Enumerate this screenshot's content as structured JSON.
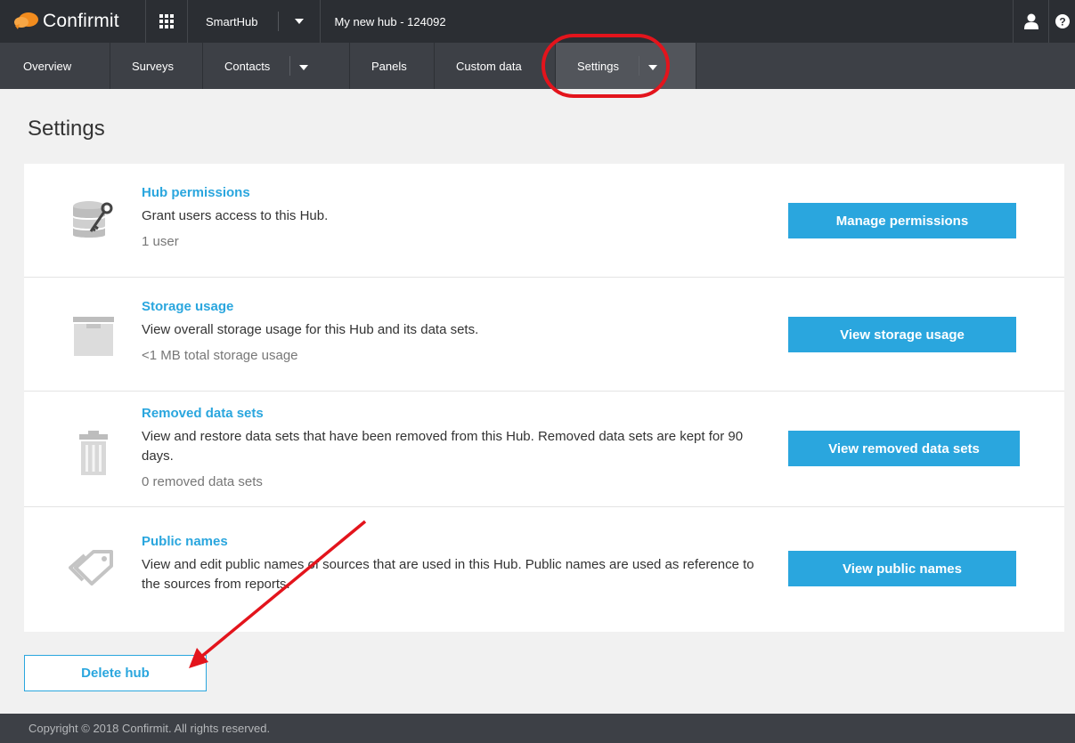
{
  "header": {
    "brand": "Confirmit",
    "app_switcher": "SmartHub",
    "hub_title": "My new hub - 124092",
    "icons": [
      "user-icon",
      "help-icon",
      "apps-grid-icon"
    ]
  },
  "nav": {
    "items": [
      {
        "label": "Overview"
      },
      {
        "label": "Surveys"
      },
      {
        "label": "Contacts"
      },
      {
        "label": "Panels"
      },
      {
        "label": "Custom data"
      },
      {
        "label": "Settings"
      }
    ],
    "active": "Settings"
  },
  "page": {
    "title": "Settings"
  },
  "sections": [
    {
      "icon": "database-key-icon",
      "title": "Hub permissions",
      "description": "Grant users access to this Hub.",
      "meta": "1 user",
      "button": "Manage permissions"
    },
    {
      "icon": "storage-box-icon",
      "title": "Storage usage",
      "description": "View overall storage usage for this Hub and its data sets.",
      "meta": "<1 MB total storage usage",
      "button": "View storage usage"
    },
    {
      "icon": "trash-icon",
      "title": "Removed data sets",
      "description": "View and restore data sets that have been removed from this Hub. Removed data sets are kept for 90 days.",
      "meta": "0 removed data sets",
      "button": "View removed data sets"
    },
    {
      "icon": "tags-icon",
      "title": "Public names",
      "description": "View and edit public names of sources that are used in this Hub. Public names are used as reference to the sources from reports.",
      "meta": "",
      "button": "View public names"
    }
  ],
  "delete_button": "Delete hub",
  "footer": "Copyright © 2018 Confirmit. All rights reserved.",
  "colors": {
    "accent": "#2aa6de",
    "topbar": "#2b2e33",
    "navbar": "#3d4046",
    "annotation": "#e3141c"
  }
}
